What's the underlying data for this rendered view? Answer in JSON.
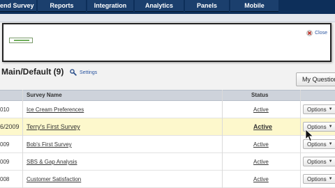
{
  "topnav": {
    "tabs": [
      {
        "label": "end Survey"
      },
      {
        "label": "Reports"
      },
      {
        "label": "Integration"
      },
      {
        "label": "Analytics"
      },
      {
        "label": "Panels"
      },
      {
        "label": "Mobile"
      }
    ]
  },
  "dialog": {
    "close_label": "Close"
  },
  "folder": {
    "title": "Main/Default (9)",
    "settings_label": "Settings",
    "my_questions_label": "My Questions"
  },
  "table": {
    "columns": {
      "name": "Survey Name",
      "status": "Status"
    },
    "rows": [
      {
        "date": "010",
        "name": "Ice Cream Preferences",
        "status": "Active",
        "options": "Options"
      },
      {
        "date": "6/2009",
        "name": "Terry's First Survey",
        "status": "Active",
        "options": "Options"
      },
      {
        "date": "009",
        "name": "Bob's First Survey",
        "status": "Active",
        "options": "Options"
      },
      {
        "date": "009",
        "name": "SBS & Gap Analysis",
        "status": "Active",
        "options": "Options"
      },
      {
        "date": "008",
        "name": "Customer Satisfaction",
        "status": "Active",
        "options": "Options"
      }
    ]
  },
  "colors": {
    "nav_background": "#0d2f5a",
    "nav_tab": "#1b3f6d",
    "highlight_row": "#fdf8cc",
    "link": "#2a55a0"
  },
  "icons": {
    "close": "close-x-icon",
    "settings": "gear-icon",
    "options_caret": "chevron-down-icon"
  }
}
